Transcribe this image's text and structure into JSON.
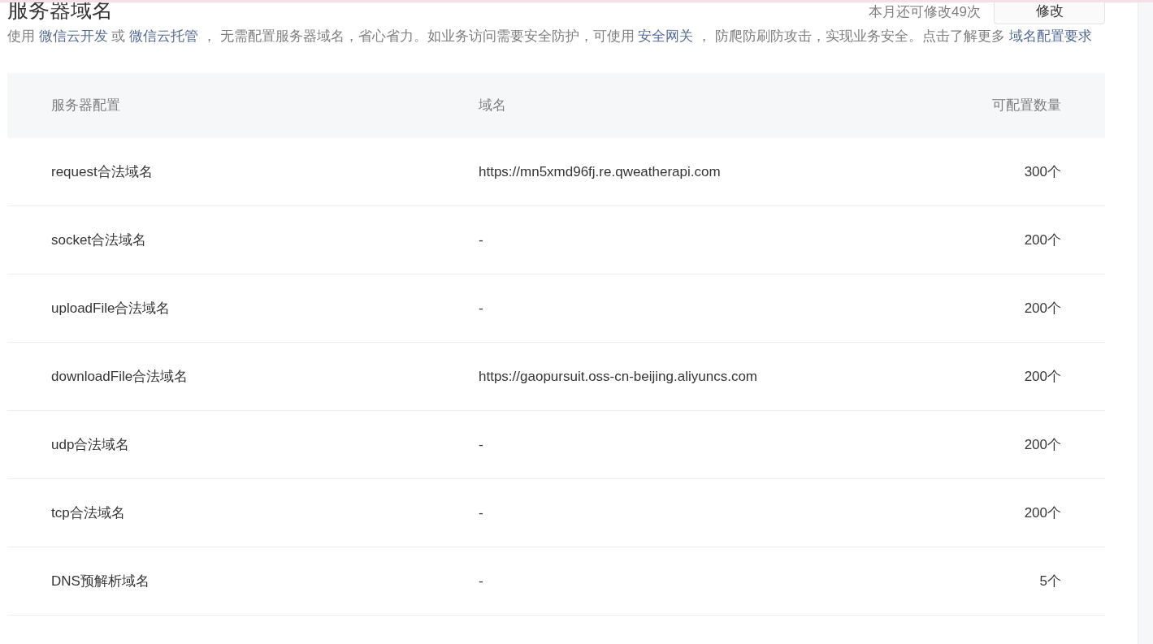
{
  "title": "服务器域名",
  "remaining": "本月还可修改49次",
  "edit_button": "修改",
  "description": [
    {
      "kind": "text",
      "text": "使用 "
    },
    {
      "kind": "link",
      "text": "微信云开发"
    },
    {
      "kind": "text",
      "text": " 或 "
    },
    {
      "kind": "link",
      "text": "微信云托管"
    },
    {
      "kind": "text",
      "text": " ， 无需配置服务器域名，省心省力。如业务访问需要安全防护，可使用 "
    },
    {
      "kind": "link",
      "text": "安全网关"
    },
    {
      "kind": "text",
      "text": " ， 防爬防刷防攻击，实现业务安全。点击了解更多 "
    },
    {
      "kind": "link",
      "text": "域名配置要求"
    }
  ],
  "table": {
    "columns": [
      "服务器配置",
      "域名",
      "可配置数量"
    ],
    "rows": [
      {
        "config": "request合法域名",
        "domain": "https://mn5xmd96fj.re.qweatherapi.com",
        "count": "300个"
      },
      {
        "config": "socket合法域名",
        "domain": "-",
        "count": "200个"
      },
      {
        "config": "uploadFile合法域名",
        "domain": "-",
        "count": "200个"
      },
      {
        "config": "downloadFile合法域名",
        "domain": "https://gaopursuit.oss-cn-beijing.aliyuncs.com",
        "count": "200个"
      },
      {
        "config": "udp合法域名",
        "domain": "-",
        "count": "200个"
      },
      {
        "config": "tcp合法域名",
        "domain": "-",
        "count": "200个"
      },
      {
        "config": "DNS预解析域名",
        "domain": "-",
        "count": "5个"
      }
    ]
  }
}
